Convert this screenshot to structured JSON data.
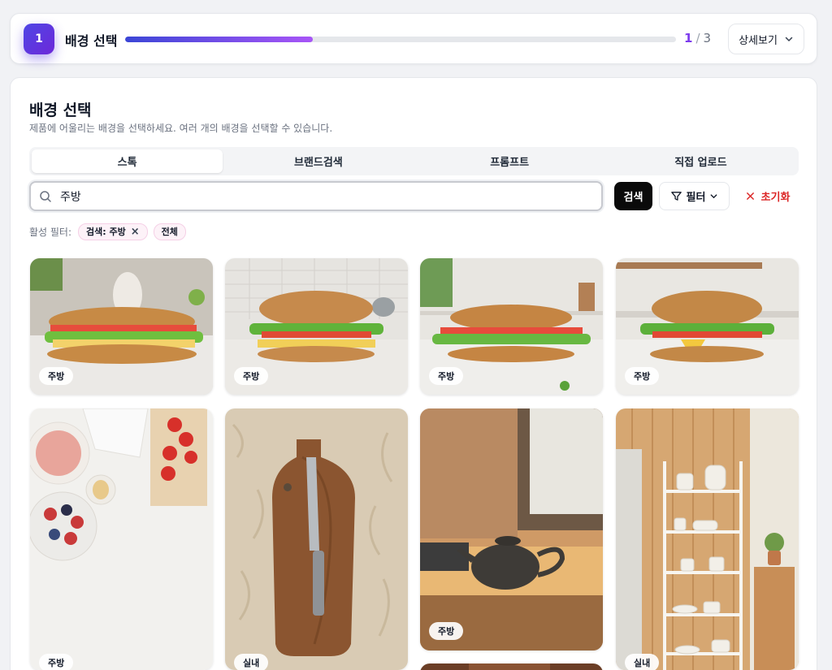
{
  "stepper": {
    "step_number": "1",
    "step_title": "배경 선택",
    "progress_fraction": 0.34,
    "current": "1",
    "separator": "/",
    "total": "3",
    "detail_label": "상세보기"
  },
  "section": {
    "title": "배경 선택",
    "description": "제품에 어울리는 배경을 선택하세요. 여러 개의 배경을 선택할 수 있습니다."
  },
  "tabs": [
    {
      "label": "스톡",
      "active": true
    },
    {
      "label": "브랜드검색",
      "active": false
    },
    {
      "label": "프롬프트",
      "active": false
    },
    {
      "label": "직접 업로드",
      "active": false
    }
  ],
  "search": {
    "value": "주방",
    "button_label": "검색",
    "filter_label": "필터",
    "reset_label": "초기화"
  },
  "active_filters": {
    "label": "활성 필터:",
    "chips": [
      {
        "label": "검색: 주방",
        "removable": true
      },
      {
        "label": "전체",
        "removable": false
      }
    ]
  },
  "images": [
    {
      "tag": "주방",
      "subject": "sandwich on kitchen counter"
    },
    {
      "tag": "주방",
      "subject": "sandwich with tile backsplash"
    },
    {
      "tag": "주방",
      "subject": "sandwich on marble countertop"
    },
    {
      "tag": "주방",
      "subject": "sandwich in bright kitchen"
    },
    {
      "tag": "주방",
      "subject": "flat lay with fruits and cutting board"
    },
    {
      "tag": "실내",
      "subject": "knife on wooden board on fur rug"
    },
    {
      "tag": "주방",
      "subject": "teapot by kitchen window"
    },
    {
      "tag": "실내",
      "subject": "white shelf with dishes"
    }
  ],
  "colors": {
    "accent_start": "#4f46e5",
    "accent_end": "#a855f7",
    "reset_red": "#dc2626",
    "search_button_bg": "#0a0a0a"
  }
}
